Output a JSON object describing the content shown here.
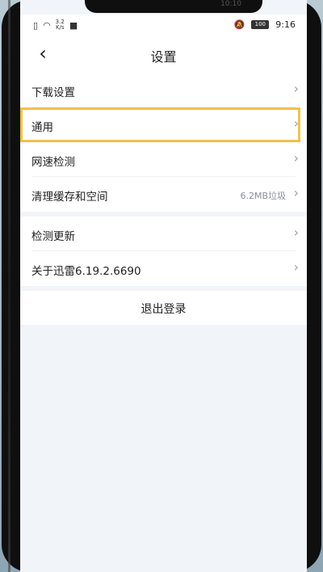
{
  "statusbar": {
    "left_speed": "3.2\nK/s",
    "time": "9:16",
    "battery": "100",
    "notch_time": "10:10"
  },
  "navbar": {
    "back_icon": "chevron-left",
    "title": "设置"
  },
  "group1": {
    "items": [
      {
        "label": "下载设置",
        "value": ""
      },
      {
        "label": "通用",
        "value": ""
      },
      {
        "label": "网速检测",
        "value": ""
      },
      {
        "label": "清理缓存和空间",
        "value": "6.2MB垃圾"
      }
    ]
  },
  "group2": {
    "items": [
      {
        "label": "检测更新",
        "value": ""
      },
      {
        "label": "关于迅雷6.19.2.6690",
        "value": ""
      }
    ]
  },
  "logout": {
    "label": "退出登录"
  },
  "colors": {
    "highlight": "#f2c14a",
    "screen_bg": "#f1f4f8",
    "text": "#222222",
    "muted": "#8a8f96"
  }
}
